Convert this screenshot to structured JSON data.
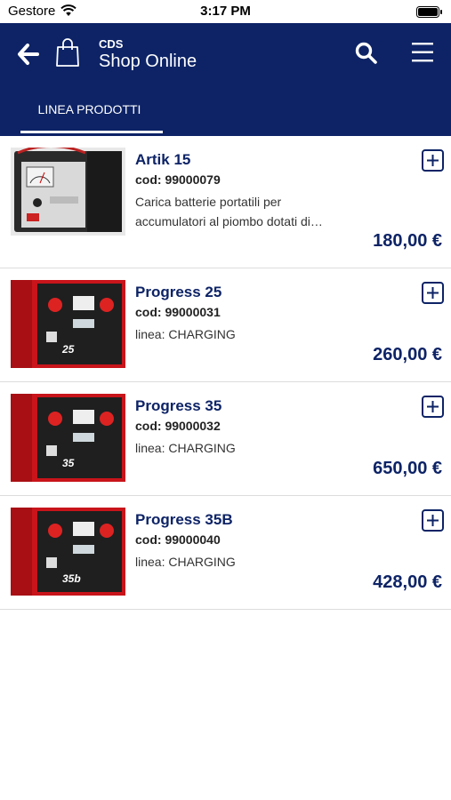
{
  "status_bar": {
    "carrier": "Gestore",
    "time": "3:17 PM"
  },
  "header": {
    "subtitle": "CDS",
    "title": "Shop Online",
    "tab_label": "LINEA PRODOTTI"
  },
  "colors": {
    "primary": "#0d2366",
    "background": "#ffffff",
    "divider": "#dcdcdc"
  },
  "products": [
    {
      "name": "Artik 15",
      "code": "cod: 99000079",
      "desc_line1": "Carica batterie portatili per",
      "desc_line2": "accumulatori al piombo dotati di…",
      "price": "180,00 €"
    },
    {
      "name": "Progress 25",
      "code": "cod: 99000031",
      "desc_line1": "linea: CHARGING",
      "price": "260,00 €"
    },
    {
      "name": "Progress 35",
      "code": "cod: 99000032",
      "desc_line1": "linea: CHARGING",
      "price": "650,00 €"
    },
    {
      "name": "Progress 35B",
      "code": "cod: 99000040",
      "desc_line1": "linea: CHARGING",
      "price": "428,00 €"
    }
  ]
}
